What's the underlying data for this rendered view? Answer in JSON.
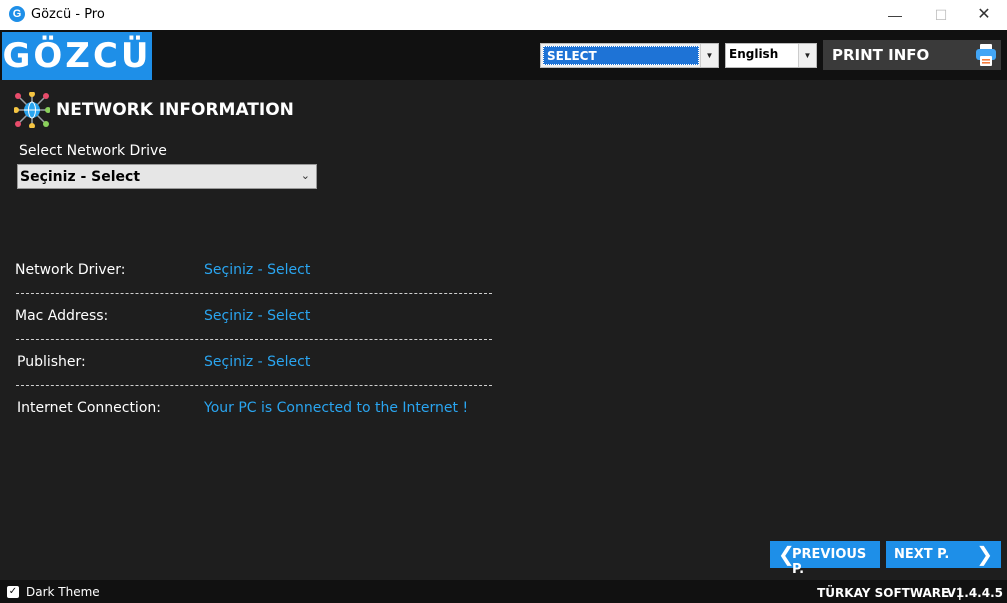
{
  "window": {
    "title": "Gözcü - Pro",
    "app_icon_letter": "G",
    "controls": {
      "minimize": "—",
      "maximize": "☐",
      "close": "✕"
    }
  },
  "header": {
    "logo": "GÖZCÜ",
    "select_value": "SELECT",
    "language_value": "English",
    "print_label": "PRINT INFO"
  },
  "section": {
    "title": "NETWORK INFORMATION",
    "drive_label": "Select Network Drive",
    "drive_select_value": "Seçiniz - Select"
  },
  "rows": [
    {
      "label": "Network Driver:",
      "value": "Seçiniz - Select"
    },
    {
      "label": "Mac Address:",
      "value": "Seçiniz - Select"
    },
    {
      "label": "Publisher:",
      "value": "Seçiniz - Select"
    },
    {
      "label": "Internet Connection:",
      "value": "Your PC is Connected to the Internet !"
    }
  ],
  "nav": {
    "prev_label": "PREVIOUS P.",
    "next_label": "NEXT P."
  },
  "footer": {
    "dark_theme_label": "Dark Theme",
    "dark_theme_checked": true,
    "company": "TÜRKAY SOFTWARE",
    "separator": "|",
    "version": "V1.4.4.5"
  },
  "colors": {
    "accent": "#1e8fe8",
    "value_text": "#2aa5f0",
    "background": "#1e1e1e",
    "header_bg": "#111111"
  },
  "icons": [
    "app-g-icon",
    "minimize-icon",
    "maximize-icon",
    "close-icon",
    "dropdown-arrow-icon",
    "printer-icon",
    "network-icon",
    "chevron-down-icon",
    "chevron-left-icon",
    "chevron-right-icon",
    "checkbox-icon"
  ]
}
